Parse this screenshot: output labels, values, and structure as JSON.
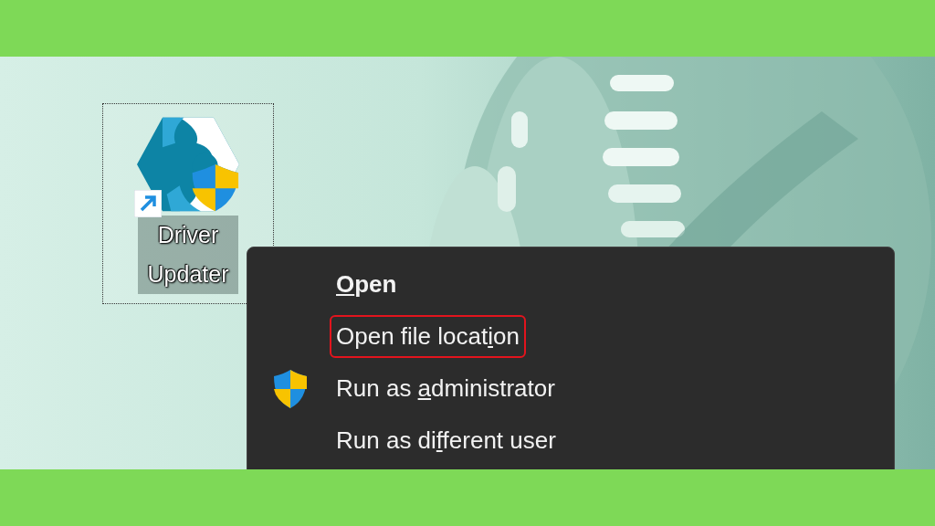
{
  "desktop_icon": {
    "label": "Driver Updater",
    "selected": true,
    "shortcut": true
  },
  "context_menu": {
    "items": [
      {
        "label_parts": [
          "O",
          "pen"
        ],
        "key_first": true,
        "default": true,
        "shield": false,
        "highlighted": false
      },
      {
        "label_parts": [
          "Open file locat",
          "i",
          "on"
        ],
        "default": false,
        "shield": false,
        "highlighted": true
      },
      {
        "label_parts": [
          "Run as ",
          "a",
          "dministrator"
        ],
        "default": false,
        "shield": true,
        "highlighted": false
      },
      {
        "label_parts": [
          "Run as di",
          "f",
          "ferent user"
        ],
        "default": false,
        "shield": false,
        "highlighted": false
      }
    ]
  }
}
